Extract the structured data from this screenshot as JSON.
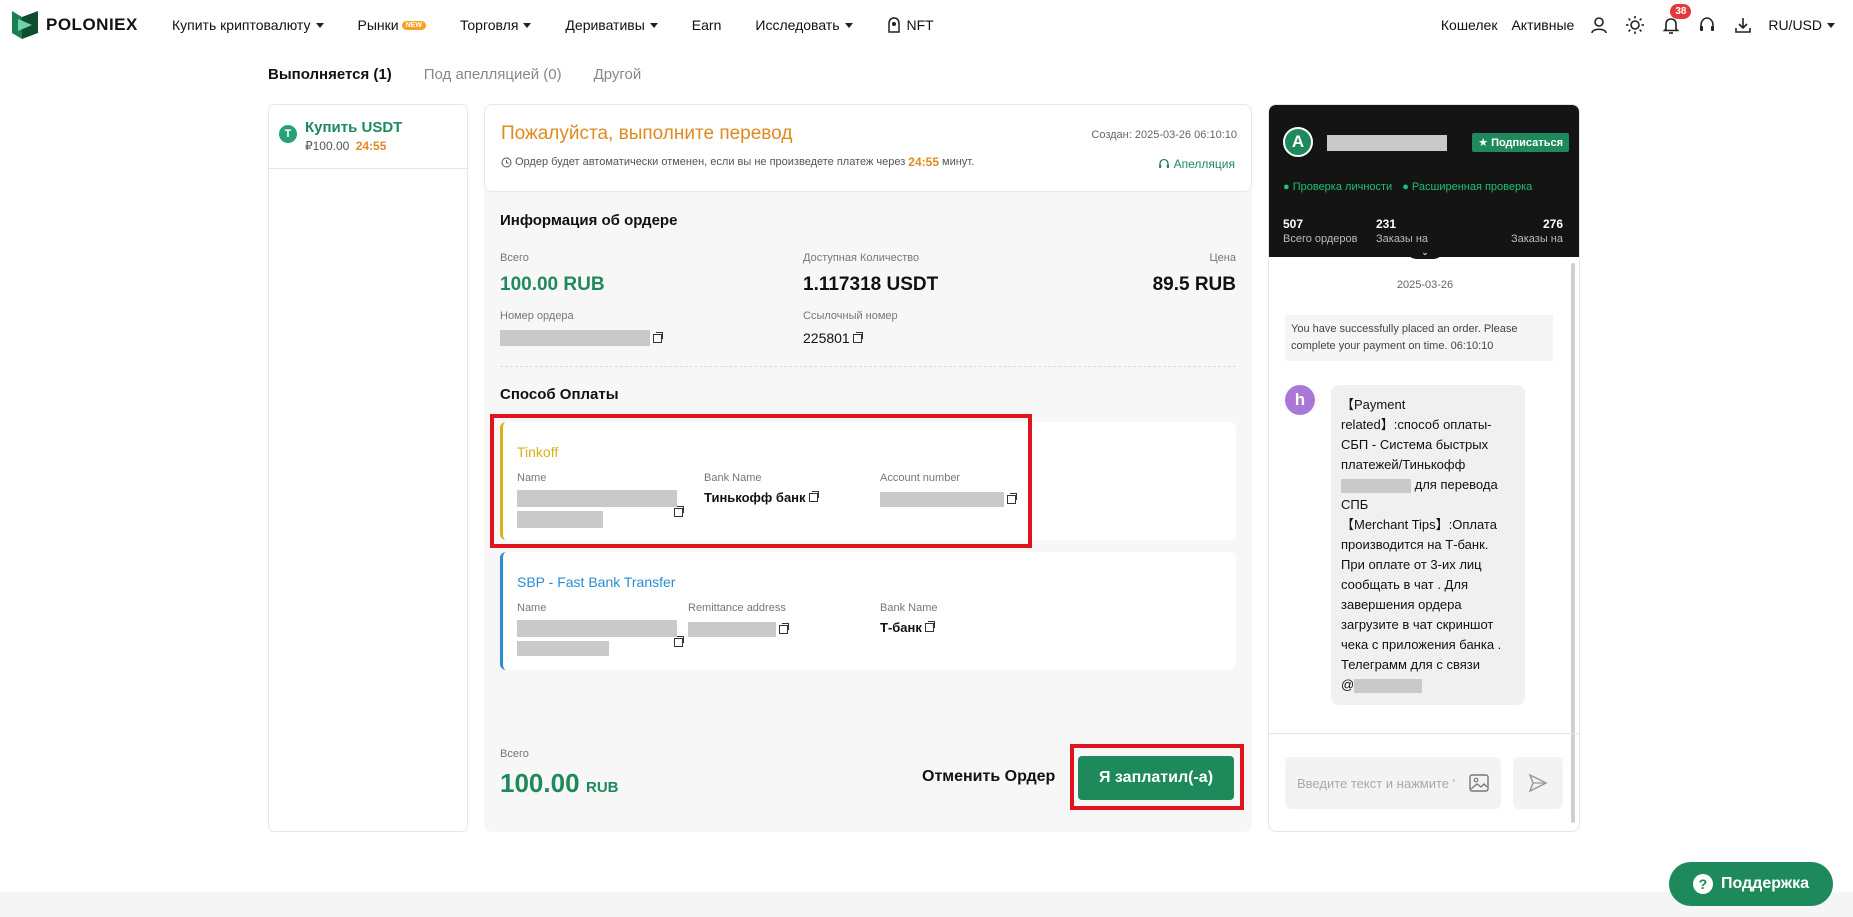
{
  "header": {
    "logo_text": "POLONIEX",
    "nav": [
      {
        "label": "Купить криптовалюту",
        "caret": true,
        "badge": ""
      },
      {
        "label": "Рынки",
        "caret": false,
        "badge": "NEW"
      },
      {
        "label": "Торговля",
        "caret": true,
        "badge": ""
      },
      {
        "label": "Деривативы",
        "caret": true,
        "badge": ""
      },
      {
        "label": "Earn",
        "caret": false,
        "badge": ""
      },
      {
        "label": "Исследовать",
        "caret": true,
        "badge": ""
      },
      {
        "label": "NFT",
        "caret": false,
        "badge": ""
      }
    ],
    "wallet": "Кошелек",
    "assets": "Активные",
    "notifications": "38",
    "currency": "RU/USD"
  },
  "tabs": {
    "in_progress": "Выполняется (1)",
    "appeal": "Под апелляцией (0)",
    "other": "Другой"
  },
  "left": {
    "title": "Купить USDT",
    "amount": "₽100.00",
    "timer": "24:55"
  },
  "status": {
    "title": "Пожалуйста, выполните перевод",
    "notice_before": "Ордер будет автоматически отменен, если вы не произведете платеж через",
    "notice_timer": "24:55",
    "notice_after": "минут.",
    "created": "Создан: 2025-03-26 06:10:10",
    "appeal": "Апелляция"
  },
  "order_info": {
    "heading": "Информация об ордере",
    "total_label": "Всего",
    "total_value": "100.00 RUB",
    "qty_label": "Доступная Количество",
    "qty_value": "1.117318 USDT",
    "price_label": "Цена",
    "price_value": "89.5 RUB",
    "order_no_label": "Номер ордера",
    "ref_label": "Ссылочный номер",
    "ref_value": "225801"
  },
  "payment": {
    "heading": "Способ Оплаты",
    "tinkoff": {
      "title": "Tinkoff",
      "name_label": "Name",
      "bank_label": "Bank Name",
      "bank_value": "Тинькофф банк",
      "acct_label": "Account number"
    },
    "sbp": {
      "title": "SBP - Fast Bank Transfer",
      "name_label": "Name",
      "remit_label": "Remittance address",
      "bank_label": "Bank Name",
      "bank_value": "Т-банк"
    }
  },
  "footer": {
    "total_label": "Всего",
    "total_amount": "100.00",
    "total_currency": "RUB",
    "cancel": "Отменить Ордер",
    "paid": "Я заплатил(-а)"
  },
  "chat": {
    "avatar": "A",
    "subscribe": "Подписаться",
    "verify1": "Проверка личности",
    "verify2": "Расширенная проверка",
    "stat1_value": "507",
    "stat1_label": "Всего ордеров",
    "stat2_value": "231",
    "stat2_label": "Заказы на",
    "stat3_value": "276",
    "stat3_label": "Заказы на",
    "date": "2025-03-26",
    "system_msg": "You have successfully placed an order. Please complete your payment on time. 06:10:10",
    "merchant_avatar": "h",
    "merchant_msg_lines": [
      "【Payment",
      "related】:способ оплаты-",
      "СБП - Система быстрых",
      "платежей/Тинькофф",
      "для перевода",
      "СПБ",
      "【Merchant Tips】:Оплата",
      "производится на Т-банк.",
      "При оплате от 3-их лиц",
      "сообщать в чат . Для",
      "завершения ордера",
      "загрузите в чат скриншот",
      "чека с приложения банка .",
      "Телеграмм для с связи",
      "@"
    ],
    "input_placeholder": "Введите текст и нажмите '"
  },
  "support": "Поддержка"
}
